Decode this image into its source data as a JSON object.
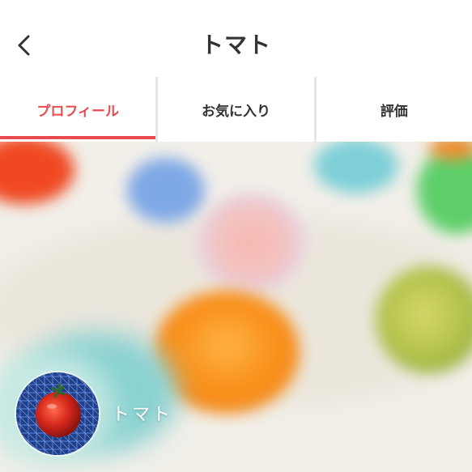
{
  "header": {
    "title": "トマト",
    "back_icon": "chevron-left-icon"
  },
  "tabs": [
    {
      "label": "プロフィール",
      "active": true
    },
    {
      "label": "お気に入り",
      "active": false
    },
    {
      "label": "評価",
      "active": false
    }
  ],
  "profile": {
    "name": "トマト",
    "avatar_icon": "tomato-photo",
    "cover_image": "blurred-colorful-balls-photo"
  },
  "colors": {
    "accent": "#e84a4f",
    "text": "#333333"
  }
}
